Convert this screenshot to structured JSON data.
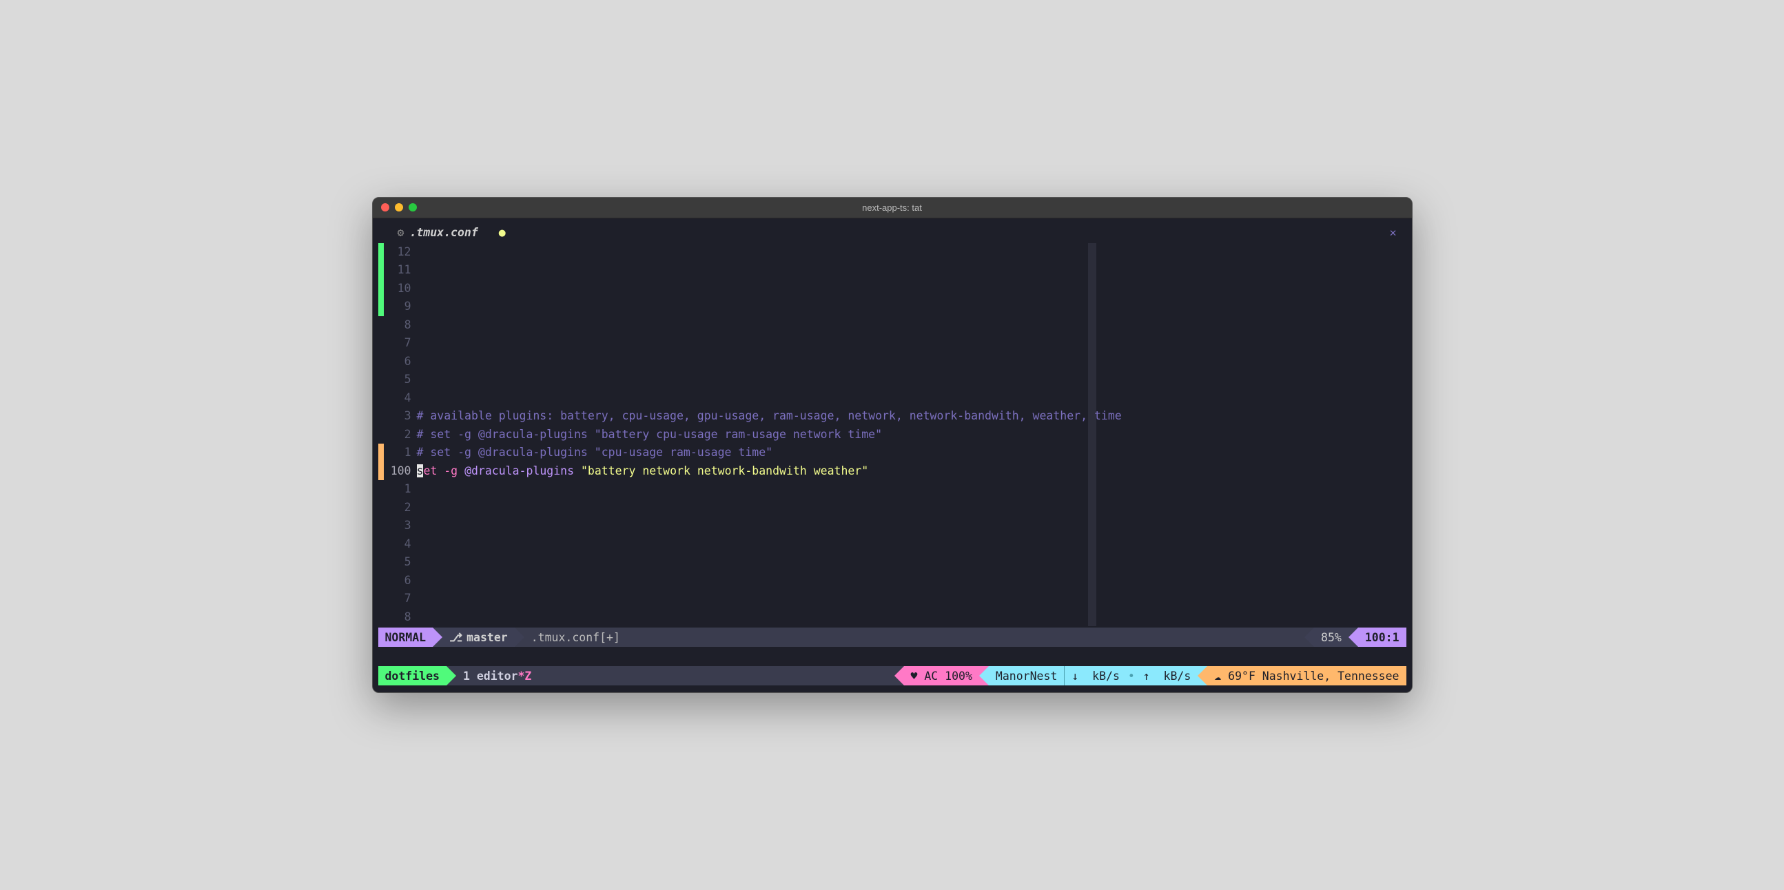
{
  "window": {
    "title": "next-app-ts: tat"
  },
  "tab": {
    "filename": ".tmux.conf"
  },
  "editor": {
    "file_lines": [
      {
        "rel": "12",
        "sign": "green",
        "text": ""
      },
      {
        "rel": "11",
        "sign": "green",
        "text": ""
      },
      {
        "rel": "10",
        "sign": "green",
        "text": ""
      },
      {
        "rel": "9",
        "sign": "green",
        "text": ""
      },
      {
        "rel": "8",
        "sign": "",
        "text": ""
      },
      {
        "rel": "7",
        "sign": "",
        "text": ""
      },
      {
        "rel": "6",
        "sign": "",
        "text": ""
      },
      {
        "rel": "5",
        "sign": "",
        "text": ""
      },
      {
        "rel": "4",
        "sign": "",
        "text": ""
      },
      {
        "rel": "3",
        "sign": "",
        "kind": "comment",
        "text": "# available plugins: battery, cpu-usage, gpu-usage, ram-usage, network, network-bandwith, weather, time"
      },
      {
        "rel": "2",
        "sign": "",
        "kind": "comment",
        "text": "# set -g @dracula-plugins \"battery cpu-usage ram-usage network time\""
      },
      {
        "rel": "1",
        "sign": "orange",
        "kind": "comment",
        "text": "# set -g @dracula-plugins \"cpu-usage ram-usage time\""
      }
    ],
    "current_line": {
      "num": "100",
      "sign": "orange",
      "tokens": {
        "keyword": "set",
        "scope": "-g",
        "option": "@dracula-plugins",
        "string": "\"battery network network-bandwith weather\""
      }
    },
    "below": [
      {
        "rel": "1"
      },
      {
        "rel": "2"
      },
      {
        "rel": "3"
      },
      {
        "rel": "4"
      },
      {
        "rel": "5"
      },
      {
        "rel": "6"
      },
      {
        "rel": "7"
      },
      {
        "rel": "8"
      }
    ]
  },
  "statusline": {
    "mode": "NORMAL",
    "branch": "master",
    "file": ".tmux.conf[+]",
    "percent": "85%",
    "pos": "100:1"
  },
  "tmux": {
    "session": "dotfiles",
    "window": {
      "index": "1",
      "name": "editor",
      "flags": "*Z"
    },
    "battery": {
      "icon": "♥",
      "label": "AC 100%"
    },
    "network": "ManorNest",
    "bandwidth": {
      "down_icon": "↓",
      "down": "kB/s",
      "up_icon": "↑",
      "up": "kB/s"
    },
    "weather": {
      "icon": "☁",
      "text": "69°F Nashville, Tennessee"
    }
  }
}
